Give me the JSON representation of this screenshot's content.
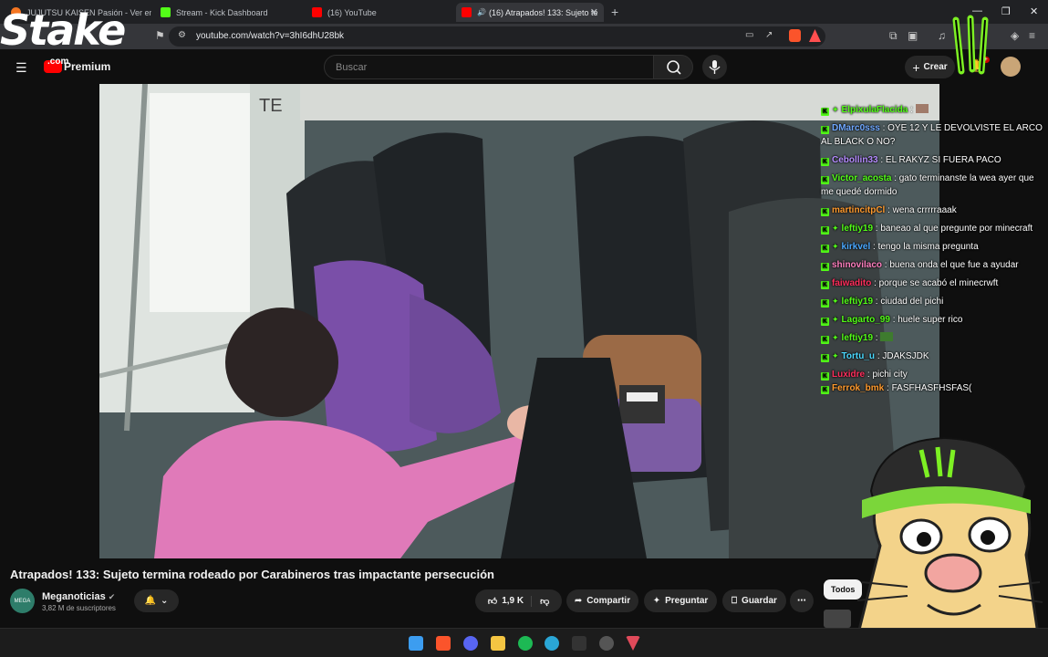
{
  "browser": {
    "tabs": [
      {
        "label": "JUJUTSU KAISEN Pasión - Ver en Cru",
        "color": "#f47521"
      },
      {
        "label": "Stream - Kick Dashboard",
        "color": "#53fc18"
      },
      {
        "label": "(16) YouTube",
        "color": "#ff0000"
      },
      {
        "label": "(16) Atrapados! 133: Sujeto te",
        "color": "#ff0000"
      }
    ],
    "url": "youtube.com/watch?v=3hI6dhU28bk"
  },
  "youtube": {
    "logo_label": "Premium",
    "search_placeholder": "Buscar",
    "create_label": "Crear",
    "notif_count": "9+"
  },
  "chat": [
    {
      "user": "ElpixulaFlacida",
      "color": "#53fc18",
      "text": ":"
    },
    {
      "user": "DMarc0sss",
      "color": "#6fa8ff",
      "text": ": OYE 12 Y LE DEVOLVISTE EL ARCO AL BLACK O NO?"
    },
    {
      "user": "Cebollin33",
      "color": "#b58cff",
      "text": ": EL RAKYZ SI FUERA PACO"
    },
    {
      "user": "Victor_acosta",
      "color": "#53fc18",
      "text": ": gato terminanste la wea ayer que me quedé dormido"
    },
    {
      "user": "martincitpCl",
      "color": "#ff9a2e",
      "text": ": wena crrrrraaak"
    },
    {
      "user": "leftiy19",
      "color": "#53fc18",
      "text": ": baneao al que pregunte por minecraft"
    },
    {
      "user": "kirkvel",
      "color": "#4aa8ff",
      "text": ": tengo la misma pregunta"
    },
    {
      "user": "shinovilaco",
      "color": "#ff7fbf",
      "text": ": buena onda el        que fue a ayudar"
    },
    {
      "user": "faiwadito",
      "color": "#ff2e5c",
      "text": ": porque se acabó el minecrwft"
    },
    {
      "user": "leftiy19",
      "color": "#53fc18",
      "text": ": ciudad del pichi"
    },
    {
      "user": "Lagarto_99",
      "color": "#53fc18",
      "text": ": huele super rico"
    },
    {
      "user": "leftiy19",
      "color": "#53fc18",
      "text": ":"
    },
    {
      "user": "Tortu_u",
      "color": "#4ad9ff",
      "text": ": JDAKSJDK"
    },
    {
      "user": "Luxidre",
      "color": "#ff2e5c",
      "text": ": pichi city"
    },
    {
      "user": "Ferrok_bmk",
      "color": "#ff9a2e",
      "text": ": FASFHASFHSFAS("
    }
  ],
  "video": {
    "title": "Atrapados! 133: Sujeto termina rodeado por Carabineros tras impactante persecución",
    "channel": "Meganoticias",
    "subscribers": "3,82 M de suscriptores",
    "likes": "1,9 K",
    "share_label": "Compartir",
    "ask_label": "Preguntar",
    "save_label": "Guardar",
    "filter_label": "Todos"
  },
  "overlay": {
    "brand": "Stake",
    "brand_suffix": ".com"
  }
}
